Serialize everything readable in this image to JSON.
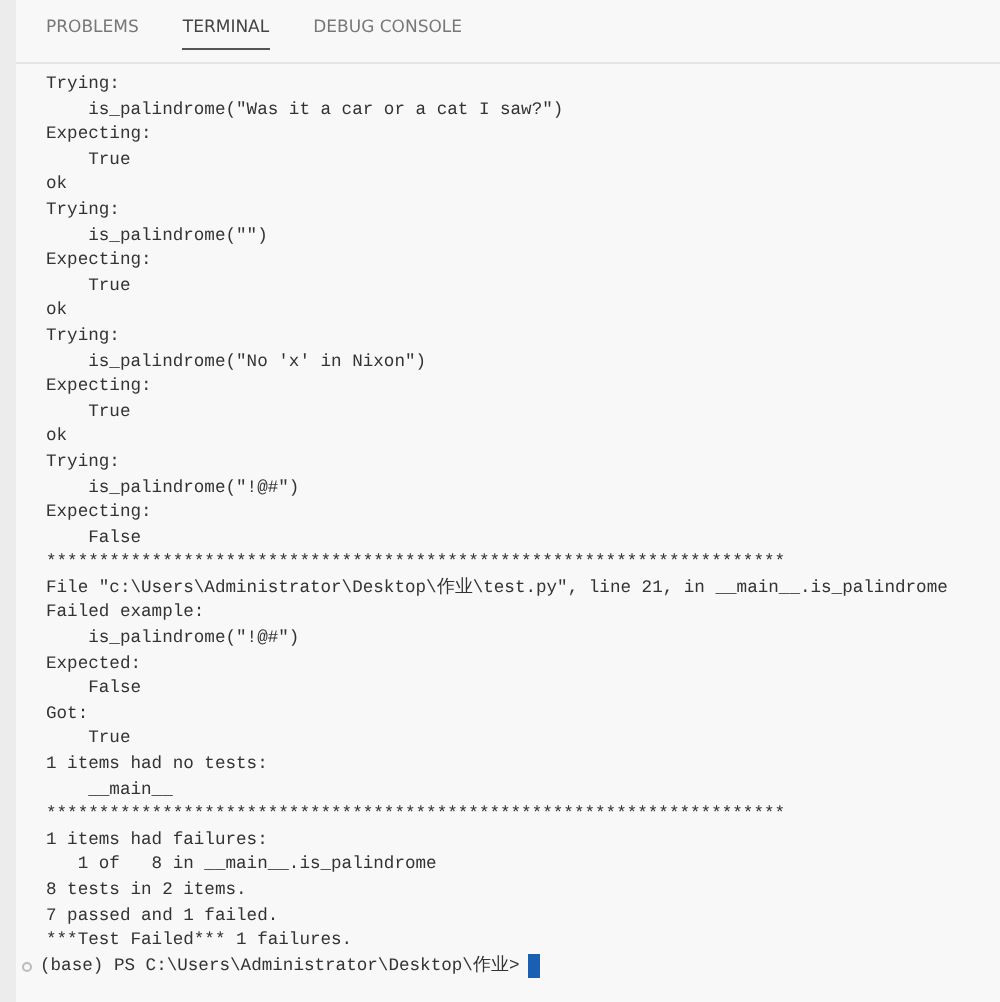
{
  "tabs": [
    {
      "label": "PROBLEMS",
      "selected": false
    },
    {
      "label": "TERMINAL",
      "selected": true
    },
    {
      "label": "DEBUG CONSOLE",
      "selected": false
    }
  ],
  "terminal": {
    "lines": [
      "Trying:",
      "    is_palindrome(\"Was it a car or a cat I saw?\")",
      "Expecting:",
      "    True",
      "ok",
      "Trying:",
      "    is_palindrome(\"\")",
      "Expecting:",
      "    True",
      "ok",
      "Trying:",
      "    is_palindrome(\"No 'x' in Nixon\")",
      "Expecting:",
      "    True",
      "ok",
      "Trying:",
      "    is_palindrome(\"!@#\")",
      "Expecting:",
      "    False",
      "**********************************************************************",
      "File \"c:\\Users\\Administrator\\Desktop\\作业\\test.py\", line 21, in __main__.is_palindrome",
      "Failed example:",
      "    is_palindrome(\"!@#\")",
      "Expected:",
      "    False",
      "Got:",
      "    True",
      "1 items had no tests:",
      "    __main__",
      "**********************************************************************",
      "1 items had failures:",
      "   1 of   8 in __main__.is_palindrome",
      "8 tests in 2 items.",
      "7 passed and 1 failed.",
      "***Test Failed*** 1 failures."
    ],
    "prompt": "(base) PS C:\\Users\\Administrator\\Desktop\\作业>"
  }
}
